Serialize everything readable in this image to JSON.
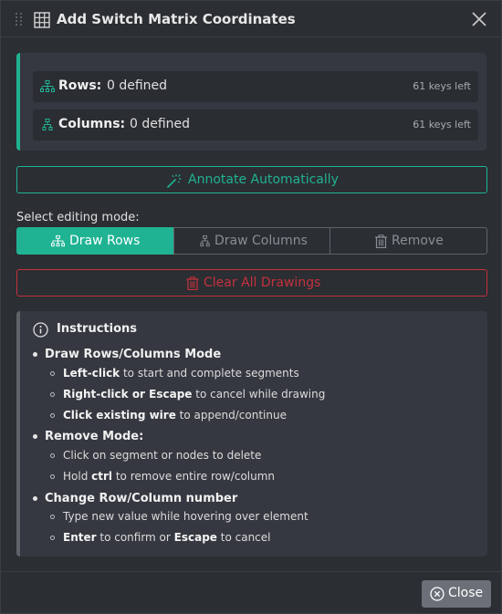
{
  "dialog": {
    "title": "Add Switch Matrix Coordinates",
    "title_icon": "grid-icon",
    "close_icon": "close-icon"
  },
  "summary": {
    "rows_label": "Rows:",
    "rows_value": "0 defined",
    "rows_keys_left": "61 keys left",
    "columns_label": "Columns:",
    "columns_value": "0 defined",
    "columns_keys_left": "61 keys left"
  },
  "annotate_label": "Annotate Automatically",
  "mode_label": "Select editing mode:",
  "modes": [
    {
      "label": "Draw Rows",
      "icon": "rows-icon",
      "active": true
    },
    {
      "label": "Draw Columns",
      "icon": "columns-icon",
      "active": false
    },
    {
      "label": "Remove",
      "icon": "trash-icon",
      "active": false
    }
  ],
  "clear_label": "Clear All Drawings",
  "instructions": {
    "title": "Instructions",
    "sections": [
      {
        "title": "Draw Rows/Columns Mode",
        "items": [
          {
            "bold": "Left-click",
            "rest": " to start and complete segments"
          },
          {
            "bold": "Right-click or Escape",
            "rest": " to cancel while drawing"
          },
          {
            "bold": "Click existing wire",
            "rest": " to append/continue"
          }
        ]
      },
      {
        "title": "Remove Mode:",
        "items": [
          {
            "plain1": "Click on segment or nodes to delete"
          },
          {
            "plain1": "Hold ",
            "bold": "ctrl",
            "rest": " to remove entire row/column"
          }
        ]
      },
      {
        "title": "Change Row/Column number",
        "items": [
          {
            "plain1": "Type new value while hovering over element"
          },
          {
            "bold": "Enter",
            "rest": " to confirm or ",
            "bold2": "Escape",
            "rest2": " to cancel"
          }
        ]
      }
    ]
  },
  "footer": {
    "close_label": "Close"
  },
  "colors": {
    "accent": "#1fb393",
    "danger": "#c4313e",
    "background": "#2b2e32"
  }
}
